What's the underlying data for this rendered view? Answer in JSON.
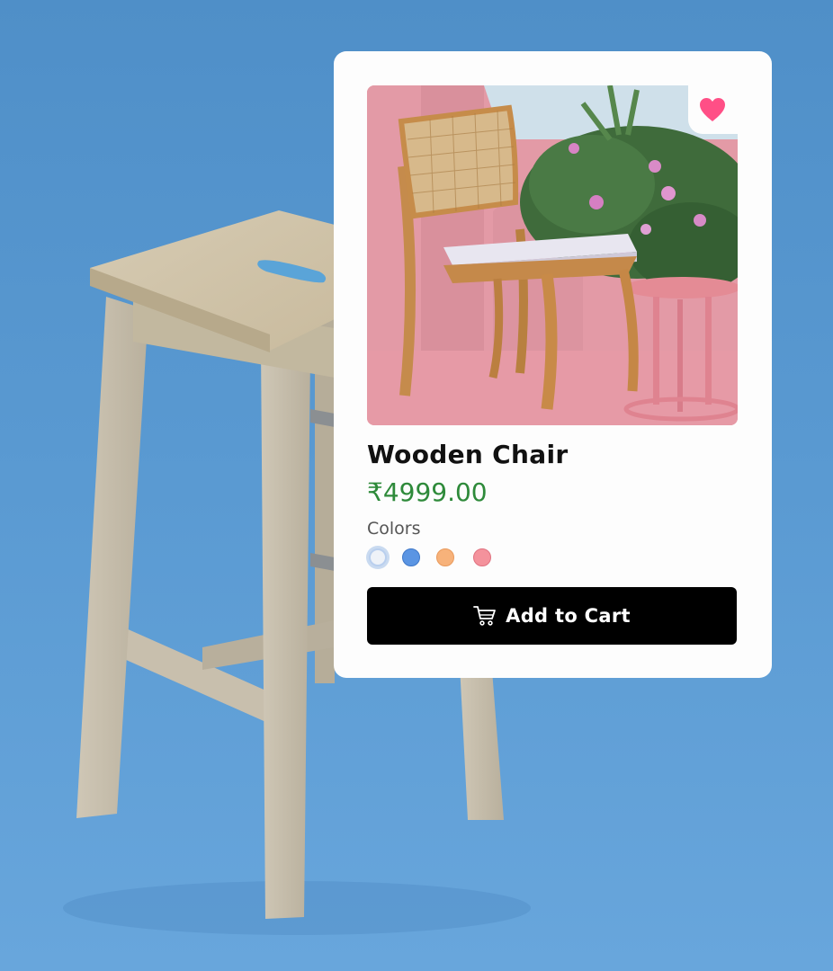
{
  "product": {
    "name": "Wooden Chair",
    "price": "₹4999.00",
    "colors_label": "Colors",
    "colors": [
      {
        "name": "white",
        "hex": "#eef2f8",
        "selected": true
      },
      {
        "name": "blue",
        "hex": "#5b95e3",
        "selected": false
      },
      {
        "name": "orange",
        "hex": "#f7b27a",
        "selected": false
      },
      {
        "name": "pink",
        "hex": "#f4929c",
        "selected": false
      }
    ],
    "favorite": true,
    "add_to_cart_label": "Add to Cart"
  },
  "icons": {
    "favorite": "heart-icon",
    "cart": "cart-icon"
  },
  "colors": {
    "card_background": "#fdfdfd",
    "price": "#2e8a3a",
    "heart": "#ff4f86",
    "button": "#000000",
    "page_background": "#5a9ad2"
  }
}
